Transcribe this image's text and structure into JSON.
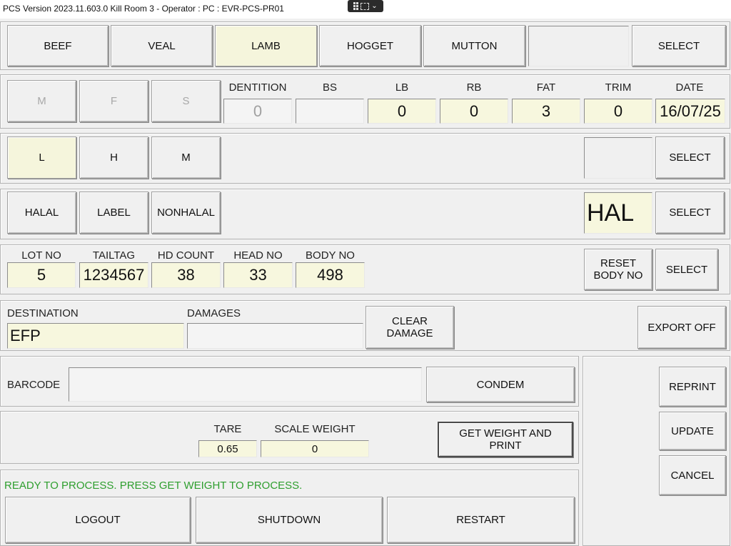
{
  "titlebar": {
    "title": "PCS Version 2023.11.603.0 Kill Room 3 - Operator :  PC : EVR-PCS-PR01",
    "chevron": "⌄"
  },
  "species": {
    "buttons": [
      {
        "label": "BEEF",
        "selected": false
      },
      {
        "label": "VEAL",
        "selected": false
      },
      {
        "label": "LAMB",
        "selected": true
      },
      {
        "label": "HOGGET",
        "selected": false
      },
      {
        "label": "MUTTON",
        "selected": false
      }
    ],
    "display_value": "",
    "select_label": "SELECT"
  },
  "sex": {
    "buttons": [
      "M",
      "F",
      "S"
    ]
  },
  "grading": {
    "fields": [
      {
        "label": "DENTITION",
        "value": "0"
      },
      {
        "label": "BS",
        "value": ""
      },
      {
        "label": "LB",
        "value": "0"
      },
      {
        "label": "RB",
        "value": "0"
      },
      {
        "label": "FAT",
        "value": "3"
      },
      {
        "label": "TRIM",
        "value": "0"
      },
      {
        "label": "DATE",
        "value": "16/07/25"
      }
    ]
  },
  "weight_class": {
    "buttons": [
      {
        "label": "L",
        "selected": true
      },
      {
        "label": "H",
        "selected": false
      },
      {
        "label": "M",
        "selected": false
      }
    ],
    "display_value": "",
    "select_label": "SELECT"
  },
  "halal": {
    "buttons": [
      "HALAL",
      "LABEL",
      "NONHALAL"
    ],
    "display_value": "HAL",
    "select_label": "SELECT"
  },
  "identity": {
    "fields": [
      {
        "label": "LOT NO",
        "value": "5"
      },
      {
        "label": "TAILTAG",
        "value": "1234567"
      },
      {
        "label": "HD COUNT",
        "value": "38"
      },
      {
        "label": "HEAD NO",
        "value": "33"
      },
      {
        "label": "BODY NO",
        "value": "498"
      }
    ],
    "reset_line1": "RESET",
    "reset_line2": "BODY NO",
    "select_label": "SELECT"
  },
  "destination": {
    "dest_label": "DESTINATION",
    "dest_value": "EFP",
    "damages_label": "DAMAGES",
    "damages_value": "",
    "clear_line1": "CLEAR",
    "clear_line2": "DAMAGE",
    "export_label": "EXPORT OFF"
  },
  "barcode": {
    "label": "BARCODE",
    "value": "",
    "condem_label": "CONDEM"
  },
  "scale": {
    "tare_label": "TARE",
    "tare_value": "0.65",
    "weight_label": "SCALE WEIGHT",
    "weight_value": "0",
    "get_line1": "GET WEIGHT AND",
    "get_line2": "PRINT"
  },
  "status": {
    "message": "READY TO PROCESS. PRESS GET WEIGHT TO PROCESS."
  },
  "system": {
    "logout": "LOGOUT",
    "shutdown": "SHUTDOWN",
    "restart": "RESTART"
  },
  "side": {
    "reprint": "REPRINT",
    "update": "UPDATE",
    "cancel": "CANCEL"
  },
  "colors": {
    "field_bg": "#f7f7de",
    "selected_bg": "#f5f5dc",
    "status_text": "#2e9e2e",
    "window_bg": "#f0f0f0"
  }
}
